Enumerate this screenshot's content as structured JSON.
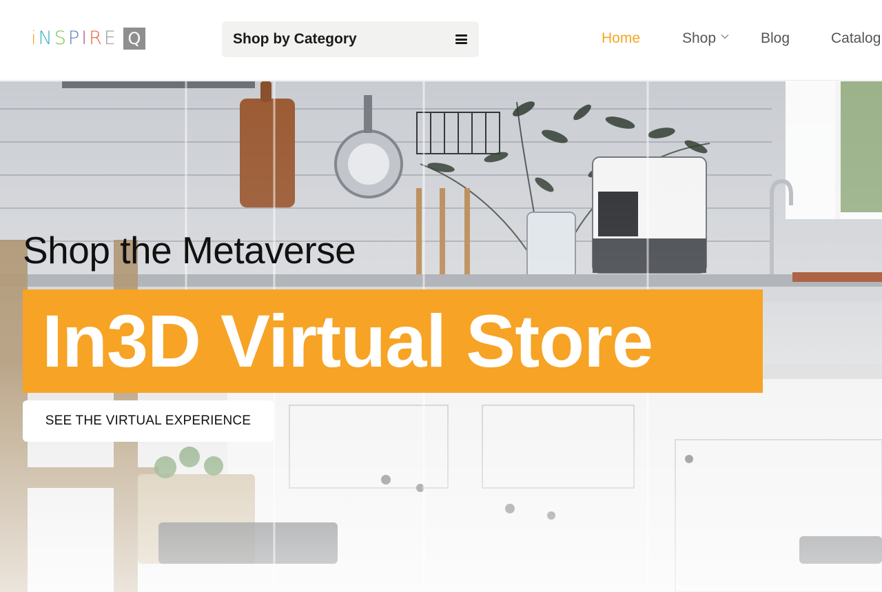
{
  "header": {
    "logo": {
      "wordmark": [
        "i",
        "N",
        "S",
        "P",
        "I",
        "R",
        "E"
      ],
      "badge": "Q",
      "badge_icon": "logo-q-icon"
    },
    "category_button": {
      "label": "Shop by Category",
      "icon": "hamburger-icon"
    },
    "nav": [
      {
        "label": "Home",
        "active": true
      },
      {
        "label": "Shop",
        "has_dropdown": true,
        "icon": "chevron-down-icon"
      },
      {
        "label": "Blog"
      },
      {
        "label": "Catalog"
      }
    ],
    "active_color": "#f5a623"
  },
  "hero": {
    "subtitle": "Shop the Metaverse",
    "title": "In3D Virtual Store",
    "cta_label": "SEE THE VIRTUAL EXPERIENCE",
    "accent_color": "#f7a325",
    "background_image": "kitchen-scene"
  }
}
